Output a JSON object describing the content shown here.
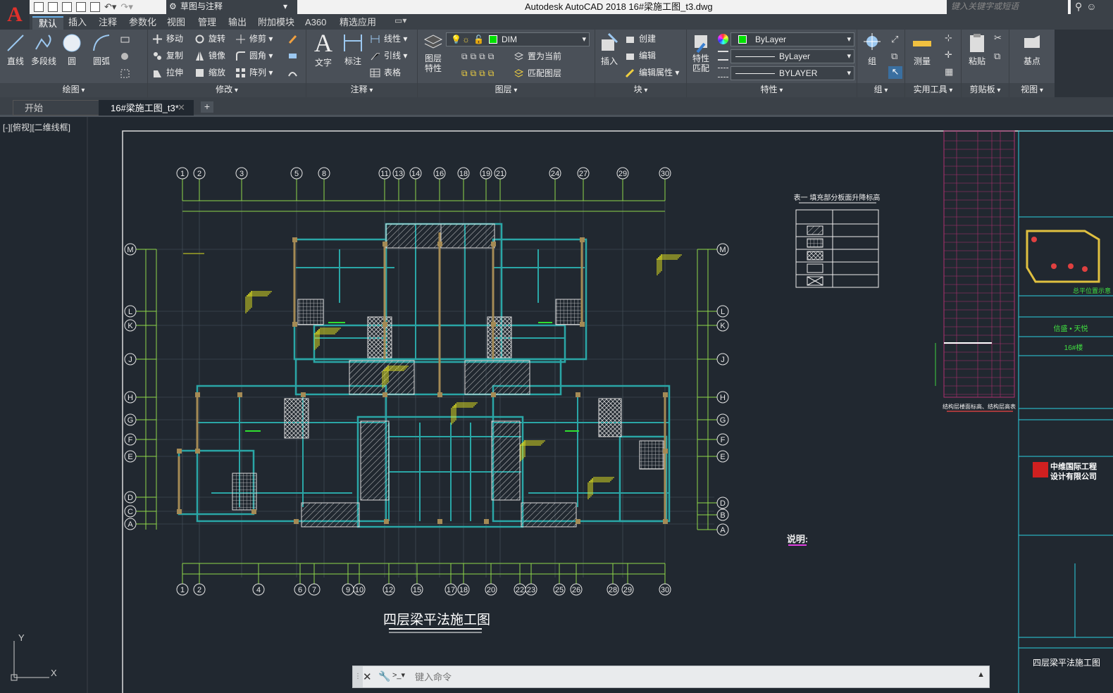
{
  "app": {
    "title": "Autodesk AutoCAD 2018    16#梁施工图_t3.dwg",
    "workspace": "草图与注释",
    "search_placeholder": "键入关键字或短语"
  },
  "ribbon_tabs": [
    "默认",
    "插入",
    "注释",
    "参数化",
    "视图",
    "管理",
    "输出",
    "附加模块",
    "A360",
    "精选应用"
  ],
  "panels": {
    "draw": {
      "label": "绘图",
      "line": "直线",
      "polyline": "多段线",
      "circle": "圆",
      "arc": "圆弧"
    },
    "modify": {
      "label": "修改",
      "move": "移动",
      "rotate": "旋转",
      "trim": "修剪",
      "copy": "复制",
      "mirror": "镜像",
      "fillet": "圆角",
      "stretch": "拉伸",
      "scale": "缩放",
      "array": "阵列"
    },
    "annotation": {
      "label": "注释",
      "text": "文字",
      "dimension": "标注",
      "linear": "线性",
      "leader": "引线",
      "table": "表格"
    },
    "layers": {
      "label": "图层",
      "props": "图层\n特性",
      "current_layer": "DIM",
      "set_current": "置为当前",
      "match": "匹配图层"
    },
    "block": {
      "label": "块",
      "insert": "插入",
      "create": "创建",
      "edit": "编辑",
      "edit_attr": "编辑属性"
    },
    "properties": {
      "label": "特性",
      "match": "特性\n匹配",
      "color": "ByLayer",
      "linetype": "ByLayer",
      "lineweight": "BYLAYER"
    },
    "groups": {
      "label": "组",
      "group": "组"
    },
    "utilities": {
      "label": "实用工具",
      "measure": "测量"
    },
    "clipboard": {
      "label": "剪贴板",
      "paste": "粘贴"
    },
    "view": {
      "label": "视图",
      "base": "基点"
    }
  },
  "doc_tabs": [
    "开始",
    "16#梁施工图_t3*"
  ],
  "viewport_label": "[-][俯视][二维线框]",
  "drawing": {
    "title": "四层梁平法施工图",
    "top_grid": [
      "1",
      "2",
      "3",
      "5",
      "8",
      "11",
      "13",
      "14",
      "16",
      "18",
      "19",
      "21",
      "24",
      "27",
      "29",
      "30"
    ],
    "bottom_grid": [
      "1",
      "2",
      "4",
      "6",
      "7",
      "9",
      "10",
      "12",
      "15",
      "17",
      "18",
      "20",
      "22",
      "23",
      "25",
      "26",
      "28",
      "29",
      "30"
    ],
    "left_grid": [
      "M",
      "L",
      "K",
      "J",
      "H",
      "G",
      "F",
      "E",
      "D",
      "C",
      "A"
    ],
    "right_grid": [
      "M",
      "L",
      "K",
      "J",
      "H",
      "G",
      "F",
      "E",
      "D",
      "B",
      "A"
    ],
    "legend_title": "表一  填充部分板面升降标高",
    "notes_label": "说明:",
    "elevation_caption": "结构层楼面标高、结构层高表",
    "company": "中维国际工程\n设计有限公司",
    "keyplan_caption": "总平位置示意",
    "project": "信盛 • 天悦",
    "building": "16#楼",
    "sheet_title": "四层梁平法施工图"
  },
  "ucs": {
    "x": "X",
    "y": "Y"
  },
  "command": {
    "placeholder": "键入命令"
  },
  "colors": {
    "accent": "#6ab0e8",
    "logo": "#e0312b",
    "column": "#a48a55",
    "beam": "#2aa6a6",
    "grid": "#8fd84a"
  }
}
